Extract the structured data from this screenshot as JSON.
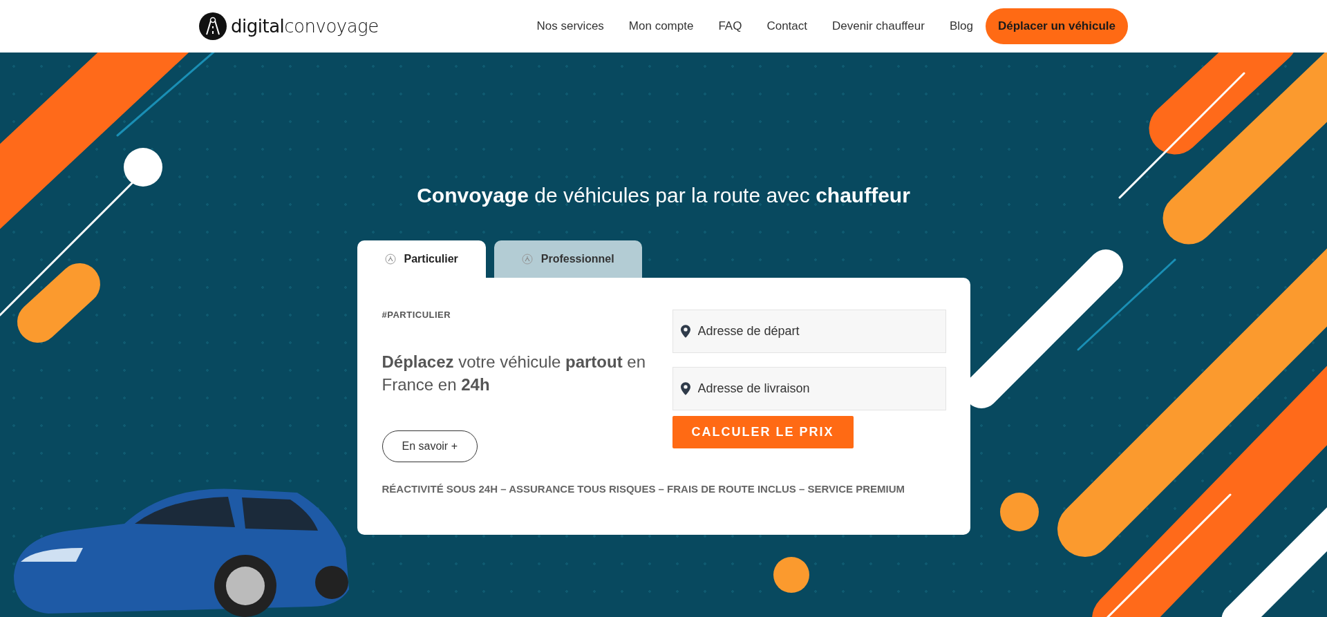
{
  "header": {
    "logo": "**digital**convoyage",
    "nav": [
      "Nos services",
      "Mon compte",
      "FAQ",
      "Contact",
      "Devenir chauffeur",
      "Blog"
    ],
    "cta": "Déplacer un véhicule"
  },
  "hero": {
    "headline": "**Convoyage** de véhicules par la route avec **chauffeur**",
    "tabs": [
      {
        "label": "Particulier",
        "selected": true
      },
      {
        "label": "Professionnel",
        "selected": false
      }
    ],
    "card": {
      "tag": "#PARTICULIER",
      "pitch": "**Déplacez** votre véhicule **partout** en France en **24h**",
      "more_button": "En savoir +",
      "fields": [
        {
          "placeholder": "Adresse de départ"
        },
        {
          "placeholder": "Adresse de livraison"
        }
      ],
      "submit": "CALCULER LE PRIX",
      "features": "RÉACTIVITÉ SOUS 24H – ASSURANCE TOUS RISQUES – FRAIS DE ROUTE INCLUS – SERVICE PREMIUM"
    }
  }
}
